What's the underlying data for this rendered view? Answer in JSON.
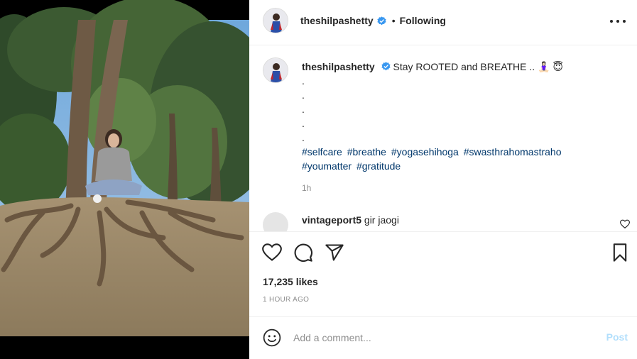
{
  "post": {
    "username": "theshilpashetty",
    "separator": "•",
    "follow_status": "Following",
    "caption": {
      "username": "theshilpashetty",
      "text": "Stay ROOTED and BREATHE .. 🧘🏻‍♀️ 😇",
      "dot_lines": [
        ".",
        ".",
        ".",
        ".",
        "."
      ],
      "hashtags": [
        "#selfcare",
        "#breathe",
        "#yogasehihoga",
        "#swasthrahomastraho",
        "#youmatter",
        "#gratitude"
      ],
      "relative_time": "1h"
    },
    "comments": [
      {
        "username": "vintageport5",
        "text": "gir jaogi"
      }
    ],
    "likes": "17,235 likes",
    "posted_ago": "1 HOUR AGO",
    "add_comment": {
      "placeholder": "Add a comment...",
      "post_label": "Post"
    }
  },
  "colors": {
    "link": "#00376b",
    "muted": "#8e8e8e",
    "verified": "#3897f0",
    "post_disabled": "#b2dffc"
  },
  "icons": [
    "verified-badge-icon",
    "more-options-icon",
    "like-heart-icon",
    "comment-icon",
    "share-icon",
    "save-bookmark-icon",
    "comment-like-heart-icon",
    "emoji-icon"
  ]
}
